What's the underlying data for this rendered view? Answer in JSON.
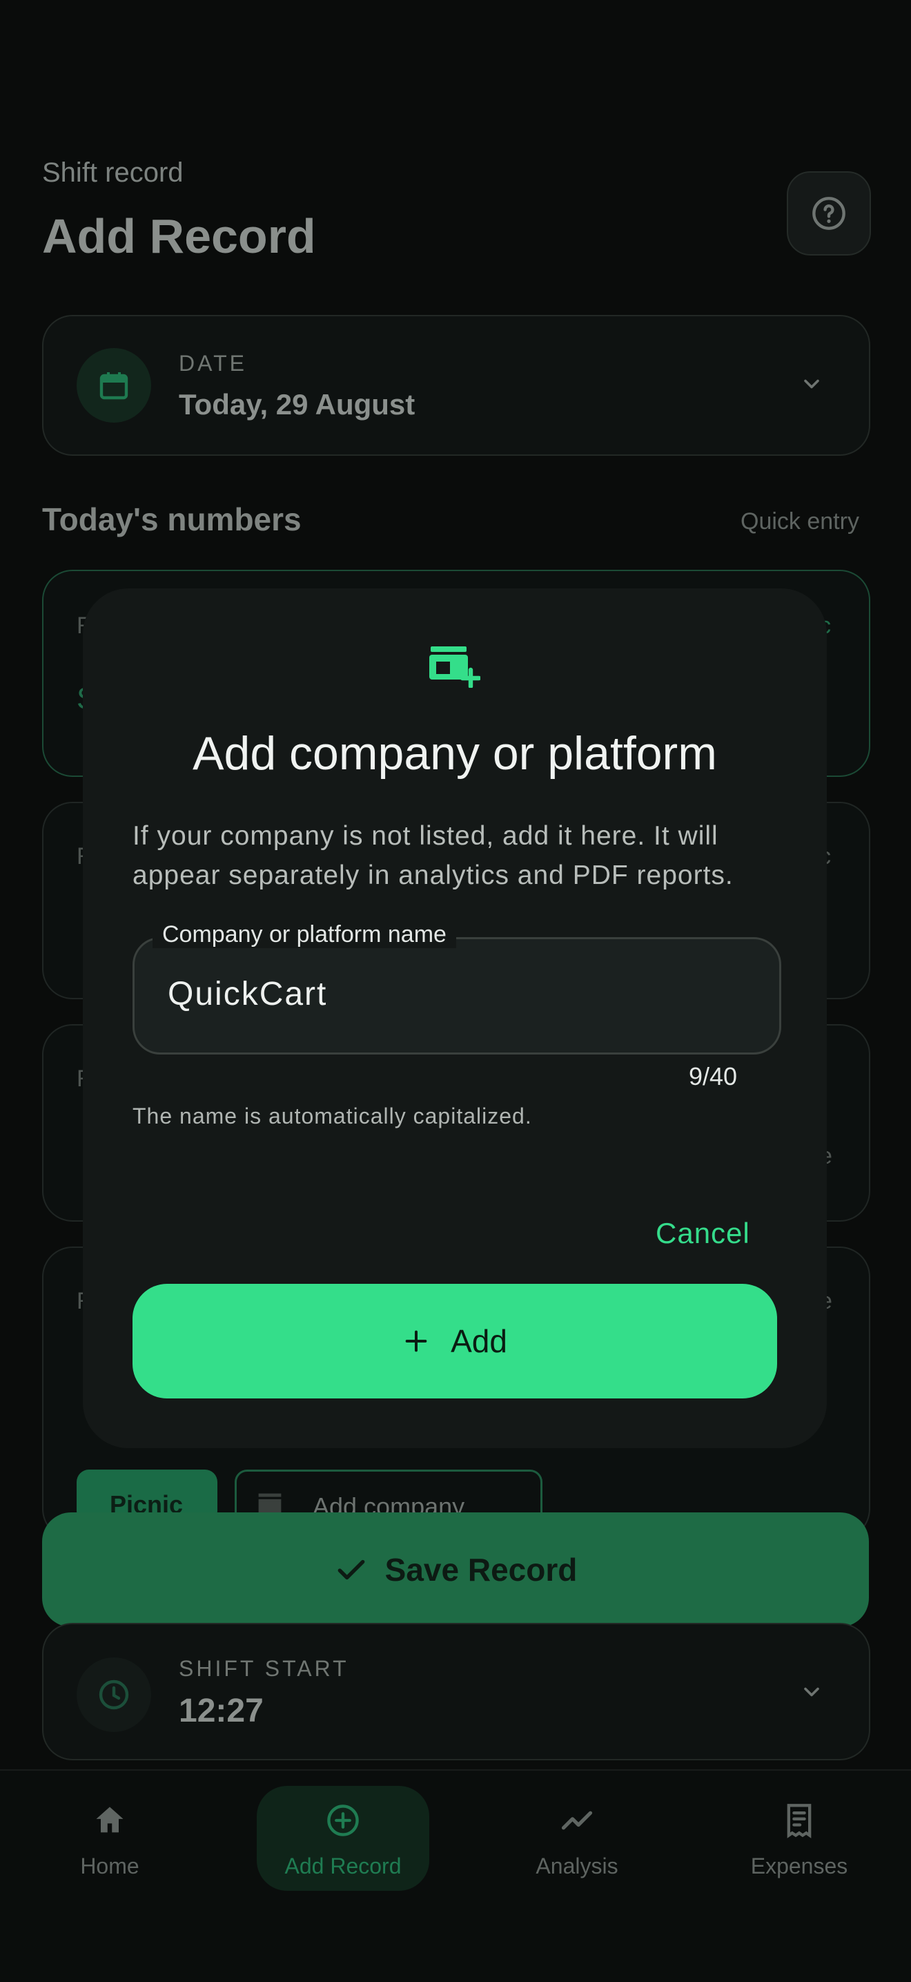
{
  "header": {
    "subtitle": "Shift record",
    "title": "Add Record"
  },
  "date_card": {
    "label": "DATE",
    "value": "Today, 29 August"
  },
  "numbers": {
    "title": "Today's numbers",
    "quick_entry": "Quick entry"
  },
  "partial_fragments": [
    "R",
    "S",
    "c",
    "R",
    "c",
    "R",
    "r",
    "e",
    "R",
    "e"
  ],
  "chips": {
    "picnic": "Picnic",
    "add_company": "Add company"
  },
  "save_button": {
    "label": "Save Record"
  },
  "shift_card": {
    "label": "SHIFT START",
    "value": "12:27"
  },
  "nav": [
    {
      "label": "Home",
      "icon": "home-icon"
    },
    {
      "label": "Add Record",
      "icon": "add-circle-icon"
    },
    {
      "label": "Analysis",
      "icon": "trending-icon"
    },
    {
      "label": "Expenses",
      "icon": "receipt-icon"
    }
  ],
  "dialog": {
    "icon": "add-store-icon",
    "title": "Add company or platform",
    "body": "If your company is not listed, add it here. It will appear separately in analytics and PDF reports.",
    "field_label": "Company or platform name",
    "field_value": "QuickCart",
    "counter": "9/40",
    "helper": "The name is automatically capitalized.",
    "cancel_label": "Cancel",
    "add_label": "Add"
  },
  "colors": {
    "accent": "#34de8a",
    "dialog_bg": "#141817",
    "page_bg": "#0a0c0b"
  }
}
